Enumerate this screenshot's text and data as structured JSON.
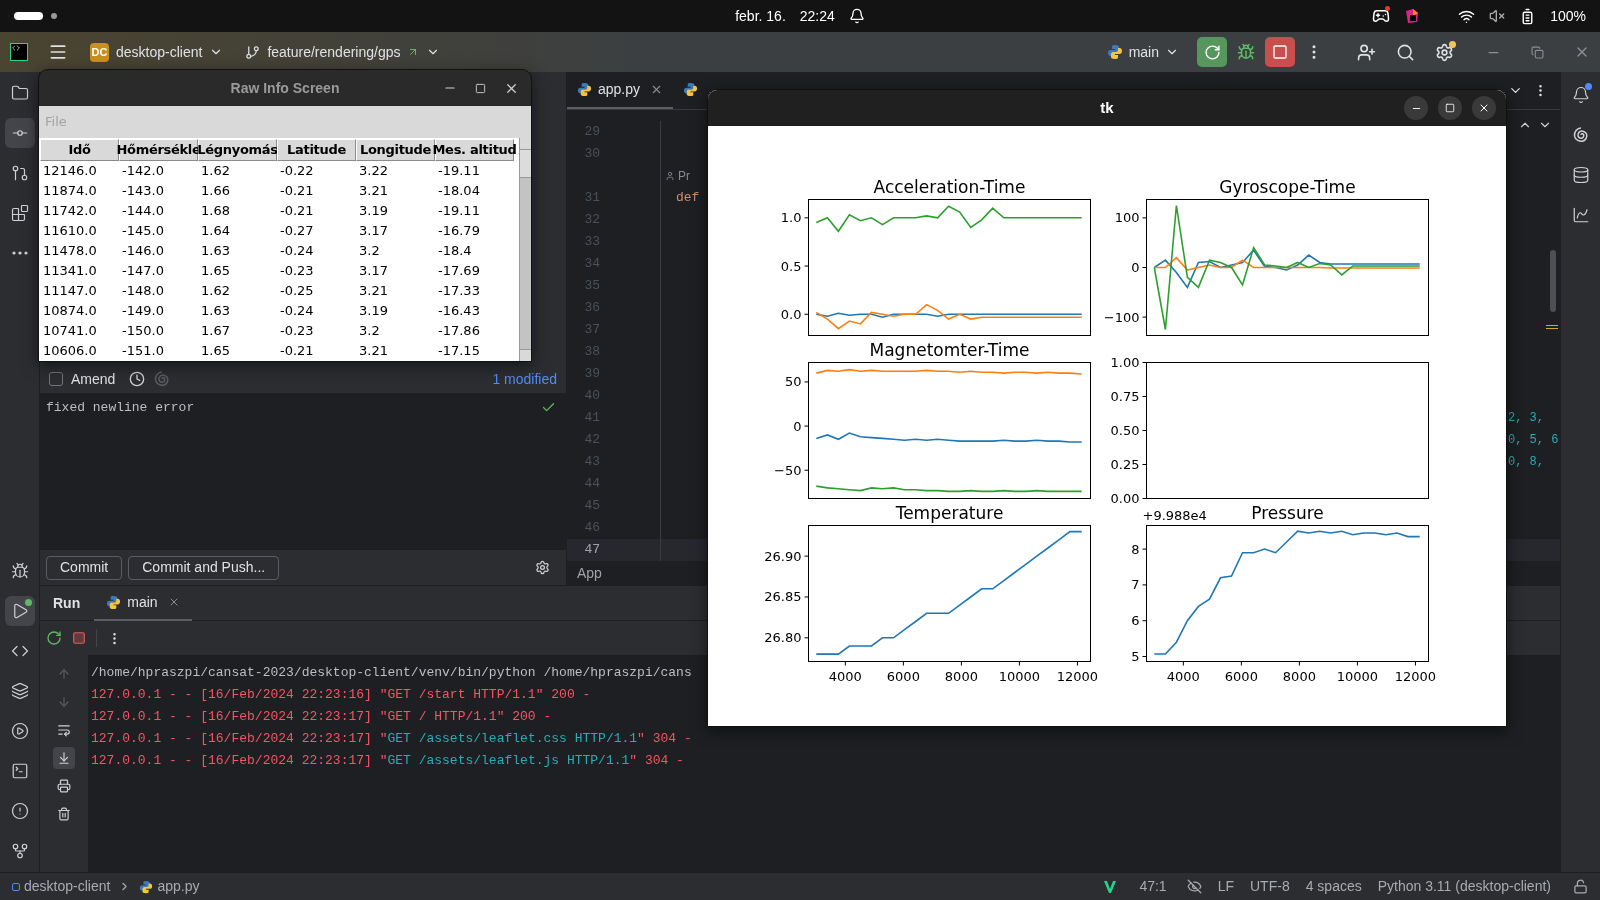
{
  "system_bar": {
    "date": "febr. 16.",
    "time": "22:24",
    "battery": "100%",
    "chat_unread": true
  },
  "ide_header": {
    "project_badge": "DC",
    "project": "desktop-client",
    "branch": "feature/rendering/gps",
    "run_config": "main",
    "settings_update": true
  },
  "left_toolbar": {
    "top": [
      {
        "kind": "project",
        "selected": false,
        "badge": false
      },
      {
        "kind": "commit",
        "selected": true,
        "badge": false
      },
      {
        "kind": "pull_requests",
        "selected": false,
        "badge": false
      },
      {
        "kind": "structure",
        "selected": false,
        "badge": false
      },
      {
        "kind": "more",
        "selected": false,
        "badge": false
      }
    ],
    "bottom": [
      {
        "kind": "debug",
        "selected": false,
        "badge": false
      },
      {
        "kind": "run",
        "selected": true,
        "badge": true
      },
      {
        "kind": "python_console",
        "selected": false,
        "badge": false
      },
      {
        "kind": "packages",
        "selected": false,
        "badge": false
      },
      {
        "kind": "services",
        "selected": false,
        "badge": false
      },
      {
        "kind": "terminal",
        "selected": false,
        "badge": false
      },
      {
        "kind": "problems",
        "selected": false,
        "badge": false
      },
      {
        "kind": "git",
        "selected": false,
        "badge": false
      }
    ]
  },
  "right_toolbar": [
    {
      "kind": "notifications",
      "badge": true
    },
    {
      "kind": "ai_assistant",
      "badge": false
    },
    {
      "kind": "database",
      "badge": false
    },
    {
      "kind": "profiler",
      "badge": false
    }
  ],
  "raw_info_window": {
    "title": "Raw Info Screen",
    "menu": [
      {
        "label": "File",
        "disabled": true
      }
    ],
    "columns": [
      "Idő",
      "Hőmérsékle",
      "Légnyomás",
      "Latitude",
      "Longitude",
      "Mes. altitud"
    ],
    "rows": [
      [
        "12146.0",
        "-142.0",
        "1.62",
        "-0.22",
        "3.22",
        "-19.11"
      ],
      [
        "11874.0",
        "-143.0",
        "1.66",
        "-0.21",
        "3.21",
        "-18.04"
      ],
      [
        "11742.0",
        "-144.0",
        "1.68",
        "-0.21",
        "3.19",
        "-19.11"
      ],
      [
        "11610.0",
        "-145.0",
        "1.64",
        "-0.27",
        "3.17",
        "-16.79"
      ],
      [
        "11478.0",
        "-146.0",
        "1.63",
        "-0.24",
        "3.2",
        "-18.4"
      ],
      [
        "11341.0",
        "-147.0",
        "1.65",
        "-0.23",
        "3.17",
        "-17.69"
      ],
      [
        "11147.0",
        "-148.0",
        "1.62",
        "-0.25",
        "3.21",
        "-17.33"
      ],
      [
        "10874.0",
        "-149.0",
        "1.63",
        "-0.24",
        "3.19",
        "-16.43"
      ],
      [
        "10741.0",
        "-150.0",
        "1.67",
        "-0.23",
        "3.2",
        "-17.86"
      ],
      [
        "10606.0",
        "-151.0",
        "1.65",
        "-0.21",
        "3.21",
        "-17.15"
      ]
    ]
  },
  "commit_panel": {
    "amend": {
      "label": "Amend",
      "checked": false
    },
    "modified": "1 modified",
    "message": "fixed newline error",
    "buttons": [
      "Commit",
      "Commit and Push..."
    ]
  },
  "editor": {
    "tabs": [
      {
        "label": "app.py",
        "selected": true
      },
      {
        "selected": false
      }
    ],
    "lines": [
      {
        "kind": "line",
        "number": "29",
        "current": false
      },
      {
        "kind": "line",
        "number": "30",
        "current": false
      },
      {
        "kind": "inlay",
        "text": "Pr"
      },
      {
        "kind": "line",
        "number": "31",
        "code": "def",
        "current": false
      },
      {
        "kind": "line",
        "number": "32",
        "current": false
      },
      {
        "kind": "line",
        "number": "33",
        "current": false
      },
      {
        "kind": "line",
        "number": "34",
        "current": false
      },
      {
        "kind": "line",
        "number": "35",
        "current": false
      },
      {
        "kind": "line",
        "number": "36",
        "current": false
      },
      {
        "kind": "line",
        "number": "37",
        "current": false
      },
      {
        "kind": "line",
        "number": "38",
        "current": false
      },
      {
        "kind": "line",
        "number": "39",
        "current": false
      },
      {
        "kind": "line",
        "number": "40",
        "current": false
      },
      {
        "kind": "line",
        "number": "41",
        "tail": "2, 3,",
        "current": false
      },
      {
        "kind": "line",
        "number": "42",
        "tail": "0, 5, 6",
        "current": false
      },
      {
        "kind": "line",
        "number": "43",
        "tail": "0, 8,",
        "current": false
      },
      {
        "kind": "line",
        "number": "44",
        "current": false
      },
      {
        "kind": "line",
        "number": "45",
        "current": false
      },
      {
        "kind": "line",
        "number": "46",
        "current": false
      },
      {
        "kind": "line",
        "number": "47",
        "current": true
      }
    ],
    "breadcrumb": "App"
  },
  "run_panel": {
    "title": "Run",
    "tabs": [
      {
        "label": "main",
        "selected": true
      }
    ],
    "gutter": [
      {
        "kind": "up",
        "disabled": true,
        "selected": false
      },
      {
        "kind": "down",
        "disabled": true,
        "selected": false
      },
      {
        "kind": "wrap",
        "disabled": false,
        "selected": false
      },
      {
        "kind": "scroll_end",
        "disabled": false,
        "selected": true
      },
      {
        "kind": "print",
        "disabled": false,
        "selected": false
      },
      {
        "kind": "clear",
        "disabled": false,
        "selected": false
      }
    ],
    "console": [
      {
        "segments": [
          {
            "text": "/home/hpraszpi/cansat-2023/desktop-client/venv/bin/python /home/hpraszpi/cans",
            "kind": "plain"
          }
        ]
      },
      {
        "segments": [
          {
            "text": "127.0.0.1 - - [16/Feb/2024 22:23:16] \"GET /start HTTP/1.1\" 200 -",
            "kind": "error"
          }
        ]
      },
      {
        "segments": [
          {
            "text": "127.0.0.1 - - [16/Feb/2024 22:23:17] \"GET / HTTP/1.1\" 200 -",
            "kind": "error"
          }
        ]
      },
      {
        "segments": [
          {
            "text": "127.0.0.1 - - [16/Feb/2024 22:23:17] \"",
            "kind": "error"
          },
          {
            "text": "GET /assets/leaflet.css HTTP/1.1",
            "kind": "info"
          },
          {
            "text": "\" 304 -",
            "kind": "error"
          }
        ]
      },
      {
        "segments": [
          {
            "text": "127.0.0.1 - - [16/Feb/2024 22:23:17] \"",
            "kind": "error"
          },
          {
            "text": "GET /assets/leaflet.js HTTP/1.1",
            "kind": "info"
          },
          {
            "text": "\" 304 -",
            "kind": "error"
          }
        ]
      }
    ]
  },
  "status_bar": {
    "path": [
      "desktop-client",
      "app.py"
    ],
    "position": "47:1",
    "line_ending": "LF",
    "encoding": "UTF-8",
    "indent": "4 spaces",
    "interpreter": "Python 3.11 (desktop-client)"
  },
  "tk_window": {
    "title": "tk",
    "plots": [
      {
        "chart_data": {
          "type": "line",
          "title": "Acceleration-Time",
          "xlim": [
            2730,
            12450
          ],
          "ylim": [
            -0.22,
            1.19
          ],
          "yticks": [
            {
              "value": 0,
              "label": "0.0"
            },
            {
              "value": 0.5,
              "label": "0.5"
            },
            {
              "value": 1,
              "label": "1.0"
            }
          ],
          "x": [
            3000,
            3380,
            3760,
            4140,
            4520,
            4900,
            5280,
            5660,
            6040,
            6420,
            6800,
            7180,
            7560,
            7940,
            8320,
            8700,
            9080,
            9460,
            9840,
            10220,
            10600,
            10980,
            11360,
            11740,
            12146
          ],
          "series": [
            {
              "color": "#1f77b4",
              "values": [
                0.0,
                -0.02,
                0.01,
                -0.01,
                0.0,
                0.0,
                -0.03,
                0.0,
                0.0,
                0.0,
                0.0,
                -0.02,
                0.0,
                0.0,
                0.0,
                0.0,
                0.0,
                0.0,
                0.0,
                0.0,
                0.0,
                0.0,
                0.0,
                0.0,
                0.0
              ]
            },
            {
              "color": "#ff7f0e",
              "values": [
                0.02,
                -0.05,
                -0.15,
                -0.07,
                -0.1,
                0.02,
                0.0,
                -0.02,
                0.0,
                0.0,
                0.1,
                0.04,
                -0.05,
                0.0,
                -0.05,
                -0.03,
                -0.03,
                -0.03,
                -0.03,
                -0.03,
                -0.03,
                -0.03,
                -0.03,
                -0.03,
                -0.03
              ]
            },
            {
              "color": "#2ca02c",
              "values": [
                0.95,
                1.0,
                0.86,
                1.03,
                0.97,
                1.0,
                0.93,
                1.0,
                1.0,
                1.0,
                1.02,
                1.0,
                1.12,
                1.06,
                0.9,
                0.98,
                1.1,
                1.0,
                1.0,
                1.0,
                1.0,
                1.0,
                1.0,
                1.0,
                1.0
              ]
            }
          ]
        }
      },
      {
        "chart_data": {
          "type": "line",
          "title": "Gyroscope-Time",
          "xlim": [
            2730,
            12450
          ],
          "ylim": [
            -137,
            137
          ],
          "yticks": [
            {
              "value": -100,
              "label": "−100"
            },
            {
              "value": 0,
              "label": "0"
            },
            {
              "value": 100,
              "label": "100"
            }
          ],
          "x": [
            3000,
            3380,
            3760,
            4140,
            4520,
            4900,
            5280,
            5660,
            6040,
            6420,
            6800,
            7180,
            7560,
            7940,
            8320,
            8700,
            9080,
            9460,
            9840,
            10220,
            10600,
            10980,
            11360,
            11740,
            12146
          ],
          "series": [
            {
              "color": "#1f77b4",
              "values": [
                0,
                15,
                -10,
                -40,
                10,
                12,
                0,
                5,
                10,
                35,
                2,
                0,
                -5,
                5,
                25,
                10,
                7,
                7,
                7,
                7,
                7,
                7,
                7,
                7,
                7
              ]
            },
            {
              "color": "#ff7f0e",
              "values": [
                0,
                0,
                20,
                -5,
                0,
                5,
                0,
                0,
                15,
                0,
                0,
                0,
                0,
                0,
                0,
                0,
                -1,
                -1,
                -1,
                -1,
                -1,
                -1,
                -1,
                -1,
                -1
              ]
            },
            {
              "color": "#2ca02c",
              "values": [
                0,
                -125,
                125,
                -20,
                -40,
                15,
                10,
                0,
                -35,
                40,
                5,
                3,
                0,
                10,
                0,
                8,
                5,
                -15,
                3,
                3,
                3,
                3,
                3,
                3,
                3
              ]
            }
          ]
        }
      },
      {
        "chart_data": {
          "type": "line",
          "title": "Magnetomter-Time",
          "xlim": [
            2730,
            12450
          ],
          "ylim": [
            -82,
            72
          ],
          "yticks": [
            {
              "value": -50,
              "label": "−50"
            },
            {
              "value": 0,
              "label": "0"
            },
            {
              "value": 50,
              "label": "50"
            }
          ],
          "x": [
            3000,
            3380,
            3760,
            4140,
            4520,
            4900,
            5280,
            5660,
            6040,
            6420,
            6800,
            7180,
            7560,
            7940,
            8320,
            8700,
            9080,
            9460,
            9840,
            10220,
            10600,
            10980,
            11360,
            11740,
            12146
          ],
          "series": [
            {
              "color": "#1f77b4",
              "values": [
                -14,
                -10,
                -15,
                -8,
                -12,
                -13,
                -14,
                -15,
                -16,
                -15,
                -16,
                -15,
                -16,
                -17,
                -17,
                -17,
                -17,
                -16,
                -17,
                -17,
                -16,
                -17,
                -17,
                -18,
                -18
              ]
            },
            {
              "color": "#ff7f0e",
              "values": [
                60,
                63,
                62,
                64,
                62,
                63,
                62,
                62,
                62,
                62,
                63,
                62,
                62,
                61,
                62,
                61,
                61,
                60,
                61,
                61,
                60,
                61,
                60,
                60,
                59
              ]
            },
            {
              "color": "#2ca02c",
              "values": [
                -68,
                -70,
                -71,
                -72,
                -73,
                -70,
                -71,
                -70,
                -72,
                -72,
                -73,
                -73,
                -74,
                -74,
                -73,
                -74,
                -74,
                -73,
                -74,
                -74,
                -73,
                -74,
                -74,
                -74,
                -74
              ]
            }
          ]
        }
      },
      {
        "chart_data": {
          "type": "line",
          "xlim": [
            2730,
            12450
          ],
          "ylim": [
            0,
            1
          ],
          "yticks": [
            {
              "value": 0,
              "label": "0.00"
            },
            {
              "value": 0.25,
              "label": "0.25"
            },
            {
              "value": 0.5,
              "label": "0.50"
            },
            {
              "value": 0.75,
              "label": "0.75"
            },
            {
              "value": 1,
              "label": "1.00"
            }
          ]
        }
      },
      {
        "chart_data": {
          "type": "line",
          "title": "Temperature",
          "xlim": [
            2730,
            12450
          ],
          "ylim": [
            26.771,
            26.9375
          ],
          "xticks": [
            4000,
            6000,
            8000,
            10000,
            12000
          ],
          "yticks": [
            {
              "value": 26.8,
              "label": "26.80"
            },
            {
              "value": 26.85,
              "label": "26.85"
            },
            {
              "value": 26.9,
              "label": "26.90"
            }
          ],
          "x": [
            3000,
            3380,
            3760,
            4140,
            4520,
            4900,
            5280,
            5660,
            6040,
            6420,
            6800,
            7180,
            7560,
            7940,
            8320,
            8700,
            9080,
            9460,
            9840,
            10220,
            10600,
            10980,
            11360,
            11740,
            12146
          ],
          "series": [
            {
              "color": "#1f77b4",
              "values": [
                26.78,
                26.78,
                26.78,
                26.79,
                26.79,
                26.79,
                26.8,
                26.8,
                26.81,
                26.82,
                26.83,
                26.83,
                26.83,
                26.84,
                26.85,
                26.86,
                26.86,
                26.87,
                26.88,
                26.89,
                26.9,
                26.91,
                26.92,
                26.93,
                26.93
              ]
            }
          ]
        }
      },
      {
        "chart_data": {
          "type": "line",
          "title": "Pressure",
          "xlim": [
            2730,
            12450
          ],
          "ylim": [
            4.86,
            8.66
          ],
          "xticks": [
            4000,
            6000,
            8000,
            10000,
            12000
          ],
          "yticks": [
            {
              "value": 5,
              "label": "5"
            },
            {
              "value": 6,
              "label": "6"
            },
            {
              "value": 7,
              "label": "7"
            },
            {
              "value": 8,
              "label": "8"
            }
          ],
          "annotations": [
            {
              "text": "+9.988e4"
            }
          ],
          "x": [
            3000,
            3380,
            3760,
            4140,
            4520,
            4900,
            5280,
            5660,
            6040,
            6420,
            6800,
            7180,
            7560,
            7940,
            8320,
            8700,
            9080,
            9460,
            9840,
            10220,
            10600,
            10980,
            11360,
            11740,
            12146
          ],
          "series": [
            {
              "color": "#1f77b4",
              "values": [
                5.07,
                5.07,
                5.4,
                6.0,
                6.4,
                6.6,
                7.2,
                7.25,
                7.9,
                7.9,
                8.0,
                7.9,
                8.2,
                8.5,
                8.45,
                8.5,
                8.45,
                8.5,
                8.4,
                8.45,
                8.45,
                8.4,
                8.45,
                8.35,
                8.35
              ]
            }
          ]
        }
      }
    ]
  }
}
